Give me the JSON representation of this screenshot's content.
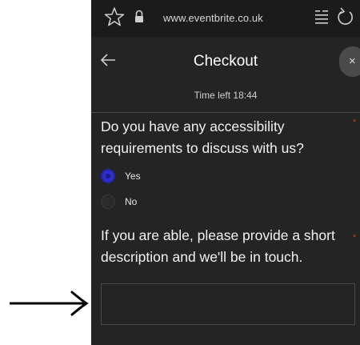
{
  "browser": {
    "url": "www.eventbrite.co.uk",
    "icons": [
      "star-icon",
      "lock-icon",
      "tabs-icon",
      "refresh-icon"
    ]
  },
  "header": {
    "title": "Checkout",
    "timer": "Time left 18:44",
    "close_label": "×",
    "icons": [
      "back-arrow-icon"
    ]
  },
  "form": {
    "accessibility_question": "Do you have any accessibility requirements to discuss with us?",
    "required_marker": "*",
    "options": [
      {
        "label": "Yes",
        "selected": true
      },
      {
        "label": "No",
        "selected": false
      }
    ],
    "description_question": "If you are able, please provide a short description and we'll be in touch.",
    "description_value": ""
  },
  "annotation": {
    "icon": "arrow-right-icon",
    "color": "#000000"
  },
  "colors": {
    "background": "#242424",
    "radio_selected": "#2e2ec8",
    "required": "#c0392b"
  }
}
